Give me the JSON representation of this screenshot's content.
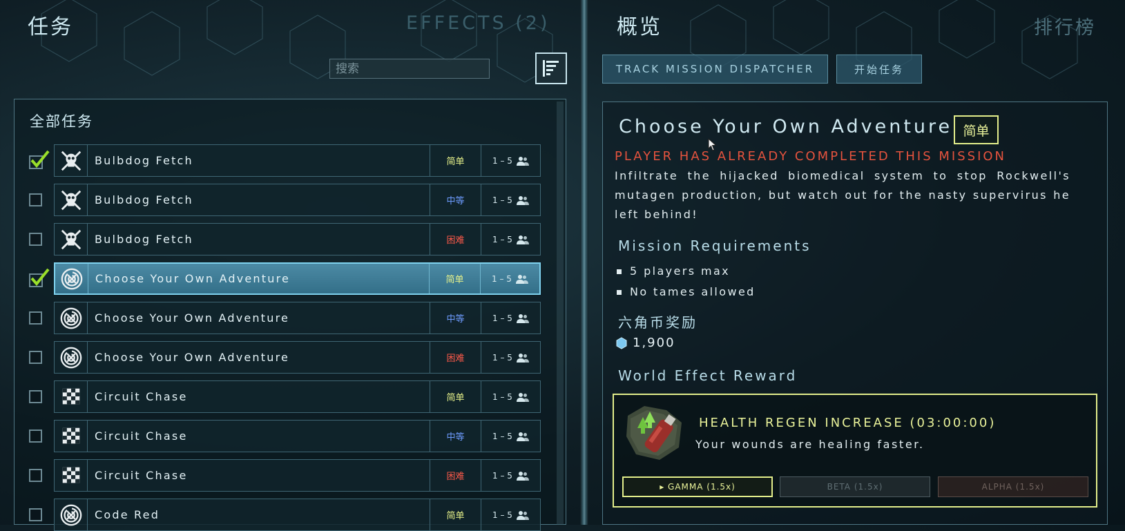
{
  "left_panel": {
    "title": "任务",
    "effects_label": "EFFECTS (2)",
    "search_placeholder": "搜索",
    "list_title": "全部任务",
    "missions": [
      {
        "name": "Bulbdog Fetch",
        "difficulty": "简单",
        "difficulty_level": "easy",
        "players": "1 – 5",
        "icon": "skull-crossbones-icon",
        "completed": true,
        "selected": false
      },
      {
        "name": "Bulbdog Fetch",
        "difficulty": "中等",
        "difficulty_level": "medium",
        "players": "1 – 5",
        "icon": "skull-crossbones-icon",
        "completed": false,
        "selected": false
      },
      {
        "name": "Bulbdog Fetch",
        "difficulty": "困难",
        "difficulty_level": "hard",
        "players": "1 – 5",
        "icon": "skull-crossbones-icon",
        "completed": false,
        "selected": false
      },
      {
        "name": "Choose Your Own Adventure",
        "difficulty": "简单",
        "difficulty_level": "easy",
        "players": "1 – 5",
        "icon": "maze-icon",
        "completed": true,
        "selected": true
      },
      {
        "name": "Choose Your Own Adventure",
        "difficulty": "中等",
        "difficulty_level": "medium",
        "players": "1 – 5",
        "icon": "maze-icon",
        "completed": false,
        "selected": false
      },
      {
        "name": "Choose Your Own Adventure",
        "difficulty": "困难",
        "difficulty_level": "hard",
        "players": "1 – 5",
        "icon": "maze-icon",
        "completed": false,
        "selected": false
      },
      {
        "name": "Circuit Chase",
        "difficulty": "简单",
        "difficulty_level": "easy",
        "players": "1 – 5",
        "icon": "checkered-flag-icon",
        "completed": false,
        "selected": false
      },
      {
        "name": "Circuit Chase",
        "difficulty": "中等",
        "difficulty_level": "medium",
        "players": "1 – 5",
        "icon": "checkered-flag-icon",
        "completed": false,
        "selected": false
      },
      {
        "name": "Circuit Chase",
        "difficulty": "困难",
        "difficulty_level": "hard",
        "players": "1 – 5",
        "icon": "checkered-flag-icon",
        "completed": false,
        "selected": false
      },
      {
        "name": "Code Red",
        "difficulty": "简单",
        "difficulty_level": "easy",
        "players": "1 – 5",
        "icon": "maze-icon",
        "completed": false,
        "selected": false
      }
    ]
  },
  "right_panel": {
    "title": "概览",
    "leaderboard_label": "排行榜",
    "track_button": "TRACK MISSION DISPATCHER",
    "start_button": "开始任务",
    "mission_title": "Choose Your Own Adventure",
    "difficulty_badge": "简单",
    "completed_notice": "PLAYER HAS ALREADY COMPLETED THIS MISSION",
    "description": "Infiltrate the hijacked biomedical system to stop Rockwell's mutagen production, but watch out for the nasty supervirus he left behind!",
    "requirements_heading": "Mission Requirements",
    "requirements": [
      "5 players max",
      "No tames allowed"
    ],
    "reward_heading": "六角币奖励",
    "reward_amount": "1,900",
    "world_effect_heading": "World Effect Reward",
    "effect_name": "HEALTH REGEN INCREASE (03:00:00)",
    "effect_description": "Your wounds are healing faster.",
    "tiers": {
      "gamma": "▸ GAMMA (1.5x)",
      "beta": "BETA (1.5x)",
      "alpha": "ALPHA (1.5x)"
    }
  },
  "colors": {
    "easy": "#e7f28a",
    "medium": "#6e9cff",
    "hard": "#ff5a4a",
    "accent": "#7fd2ee",
    "completed_text": "#e5533e"
  },
  "icons": {
    "filter": "list-filter-icon",
    "coin": "hexagon-coin-icon",
    "player": "players-icon",
    "check": "checkmark-icon"
  }
}
